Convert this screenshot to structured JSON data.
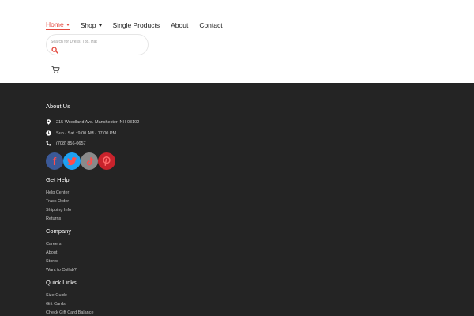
{
  "nav": {
    "items": [
      {
        "label": "Home",
        "dropdown": true,
        "active": true
      },
      {
        "label": "Shop",
        "dropdown": true,
        "active": false
      },
      {
        "label": "Single Products",
        "dropdown": false,
        "active": false
      },
      {
        "label": "About",
        "dropdown": false,
        "active": false
      },
      {
        "label": "Contact",
        "dropdown": false,
        "active": false
      }
    ]
  },
  "search": {
    "placeholder": "Search for Dress, Top, Hat",
    "value": ""
  },
  "footer": {
    "about": {
      "heading": "About Us",
      "address": "215 Woodland Ave. Manchester, NH 03102",
      "hours": "Sun - Sat : 9:00 AM - 17:00 PM",
      "phone": "(708) 856-0657"
    },
    "social": [
      "facebook",
      "twitter",
      "tiktok",
      "pinterest"
    ],
    "get_help": {
      "heading": "Get Help",
      "links": [
        "Help Center",
        "Track Order",
        "Shipping Info",
        "Returns"
      ]
    },
    "company": {
      "heading": "Company",
      "links": [
        "Careers",
        "About",
        "Stores",
        "Want to Collab?"
      ]
    },
    "quick_links": {
      "heading": "Quick Links",
      "links": [
        "Size Guide",
        "Gift Cards",
        "Check Gift Card Balance"
      ]
    }
  },
  "colors": {
    "accent": "#e4493f",
    "footer_bg": "#242424",
    "social_icon": "#ff4d4d"
  }
}
